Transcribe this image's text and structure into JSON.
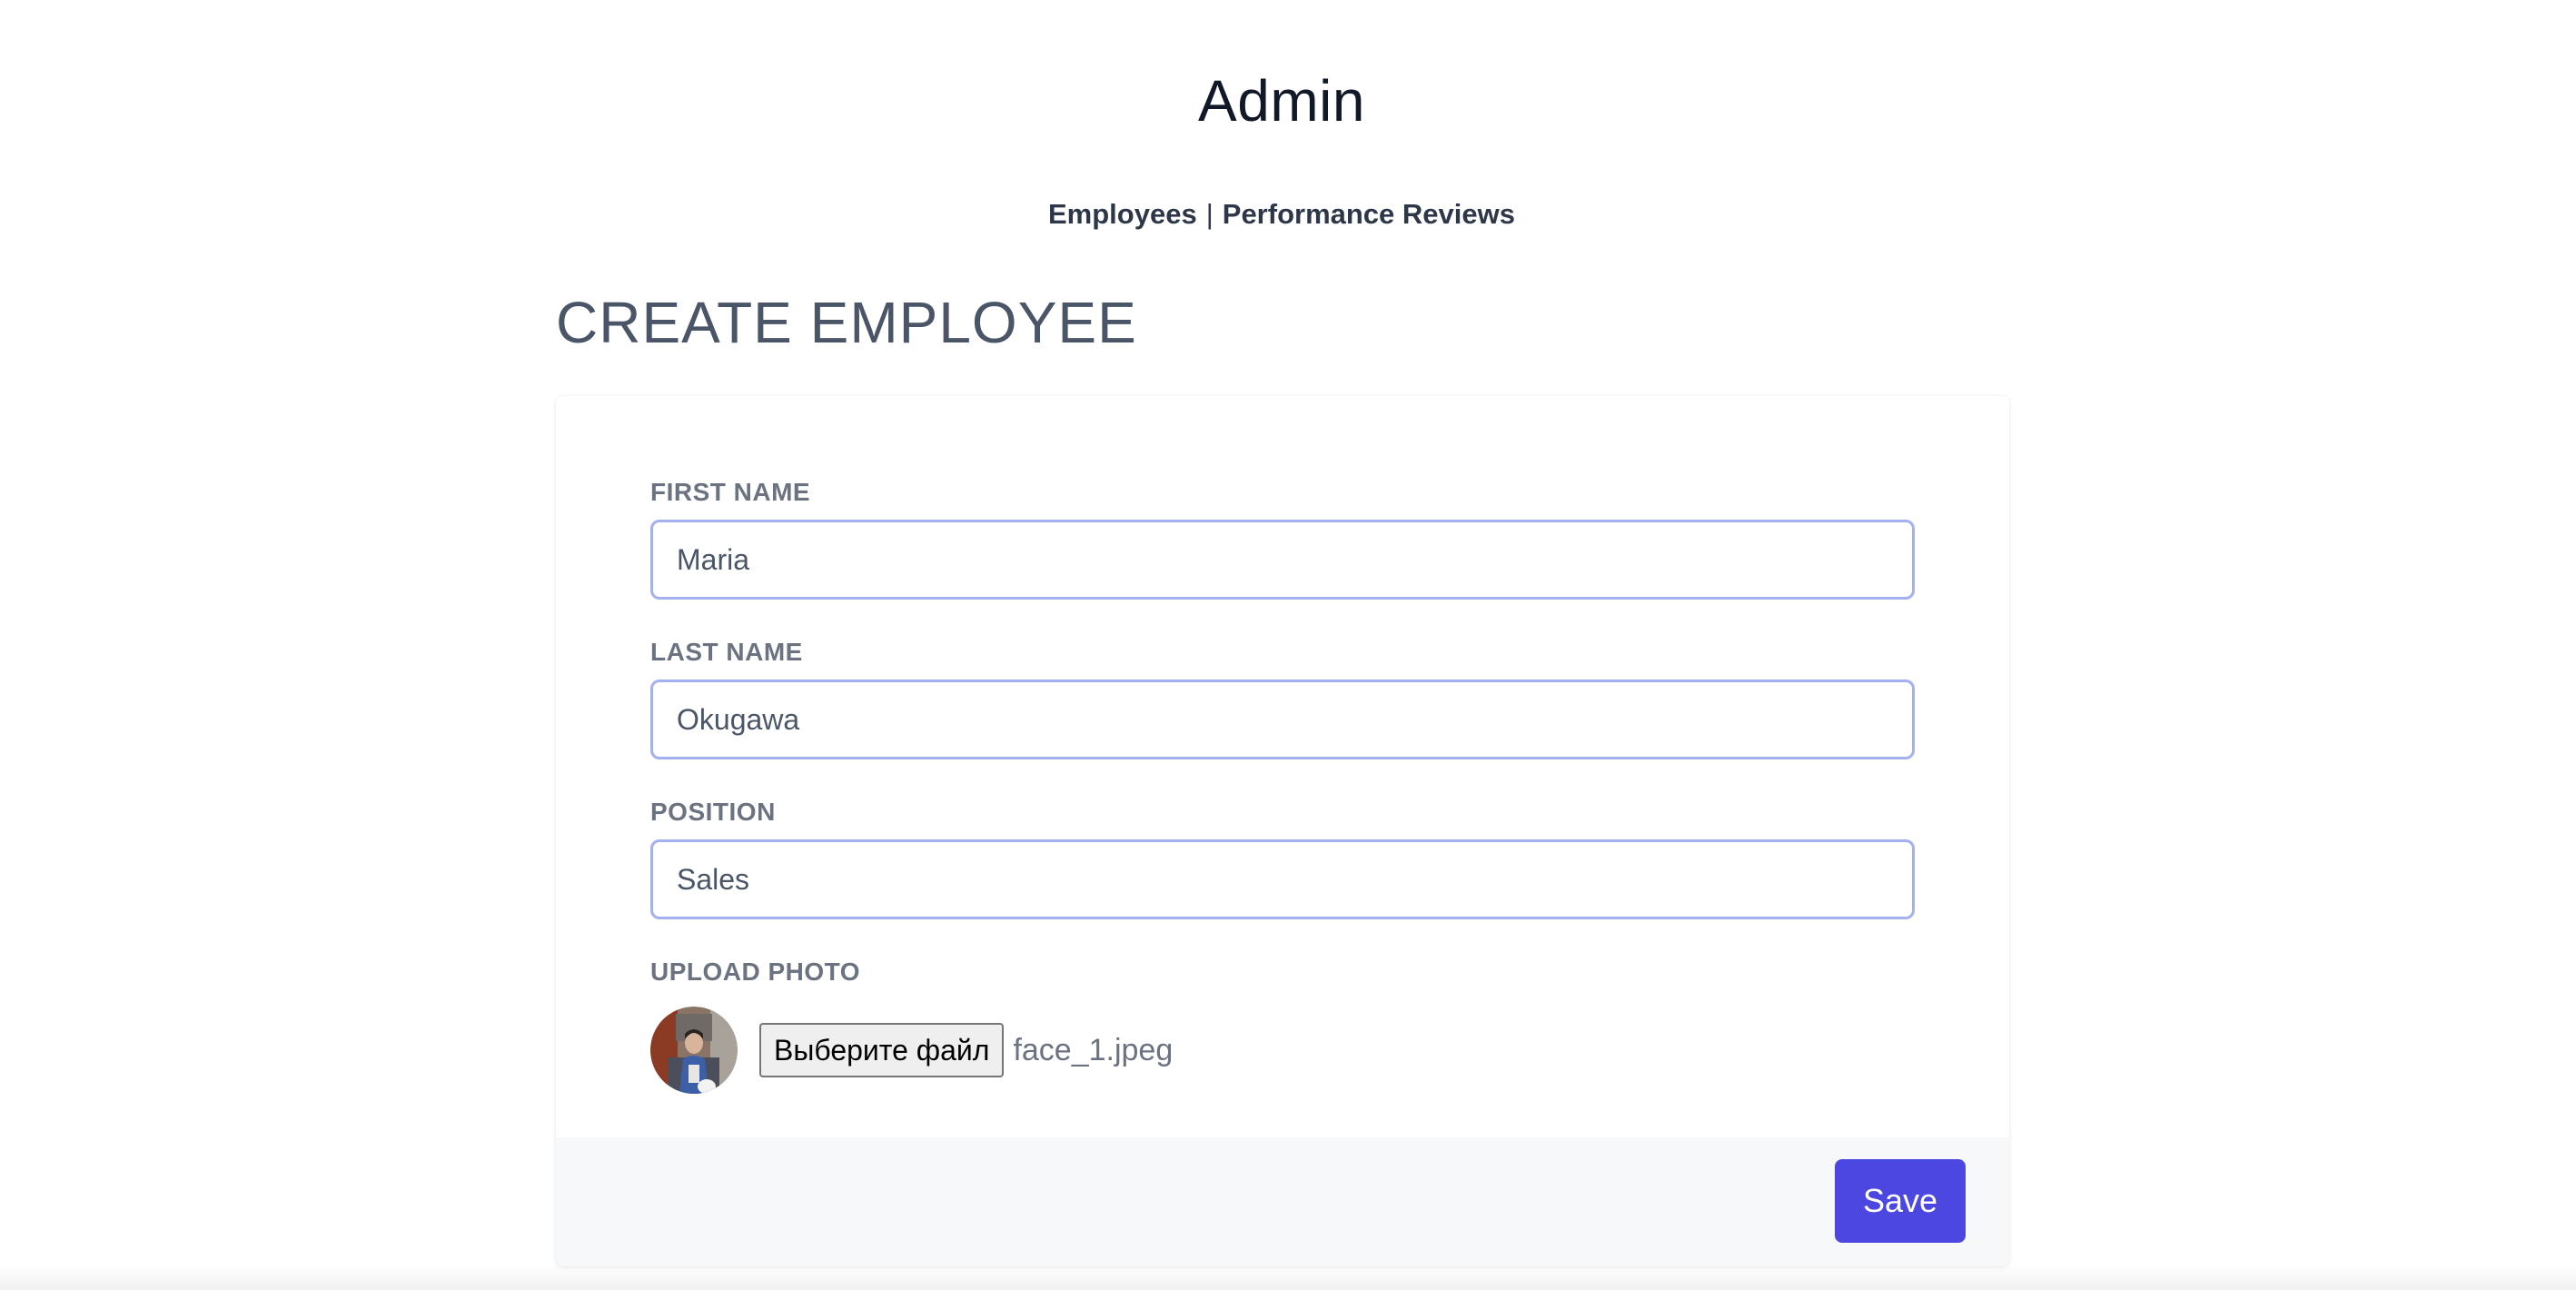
{
  "header": {
    "app_title": "Admin"
  },
  "nav": {
    "items": [
      {
        "label": "Employees"
      },
      {
        "label": "Performance Reviews"
      }
    ],
    "separator": "|"
  },
  "page": {
    "heading": "CREATE EMPLOYEE"
  },
  "form": {
    "first_name": {
      "label": "FIRST NAME",
      "value": "Maria"
    },
    "last_name": {
      "label": "LAST NAME",
      "value": "Okugawa"
    },
    "position": {
      "label": "POSITION",
      "value": "Sales"
    },
    "photo": {
      "label": "UPLOAD PHOTO",
      "button_label": "Выберите файл",
      "file_name": "face_1.jpeg",
      "avatar_icon": "person-photo"
    },
    "save_label": "Save"
  },
  "colors": {
    "accent": "#4c47e0",
    "input_border": "#a3b1ef",
    "footer_bg": "#f7f8fa"
  }
}
